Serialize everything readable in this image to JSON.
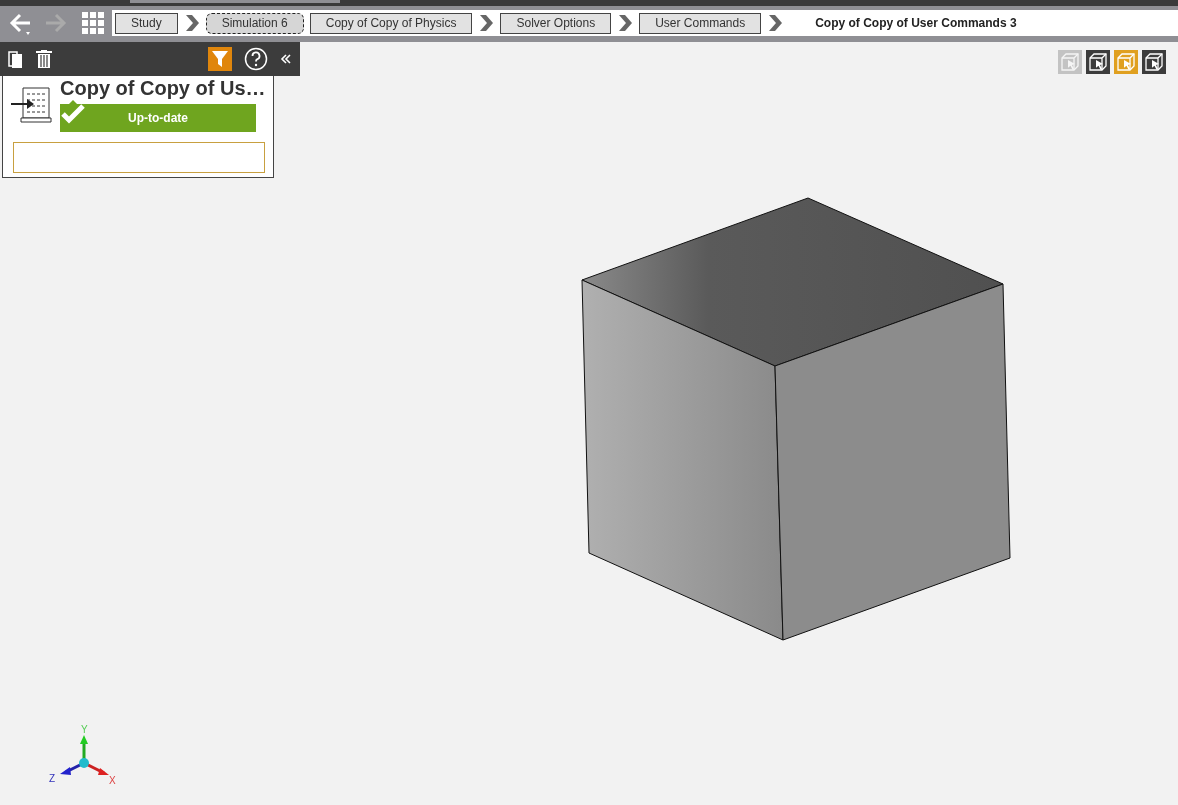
{
  "breadcrumbs": [
    {
      "label": "Study",
      "kind": "button",
      "focused": false,
      "arrow_after": true
    },
    {
      "label": "Simulation 6",
      "kind": "button",
      "focused": true,
      "arrow_after": false
    },
    {
      "label": "Copy of Copy of Physics",
      "kind": "button",
      "focused": false,
      "arrow_after": true
    },
    {
      "label": "Solver Options",
      "kind": "button",
      "focused": false,
      "arrow_after": true
    },
    {
      "label": "User Commands",
      "kind": "button",
      "focused": false,
      "arrow_after": true
    },
    {
      "label": "Copy of Copy of User Commands 3",
      "kind": "current"
    }
  ],
  "panel": {
    "filter_on": true,
    "title": "Copy of Copy of Us…",
    "status": "Up-to-date",
    "up_to_date": true
  },
  "view_modes": [
    {
      "selected": false,
      "disabled": true
    },
    {
      "selected": false,
      "disabled": false
    },
    {
      "selected": true,
      "disabled": false
    },
    {
      "selected": false,
      "disabled": false
    }
  ],
  "axes": {
    "x": "X",
    "y": "Y",
    "z": "Z"
  }
}
